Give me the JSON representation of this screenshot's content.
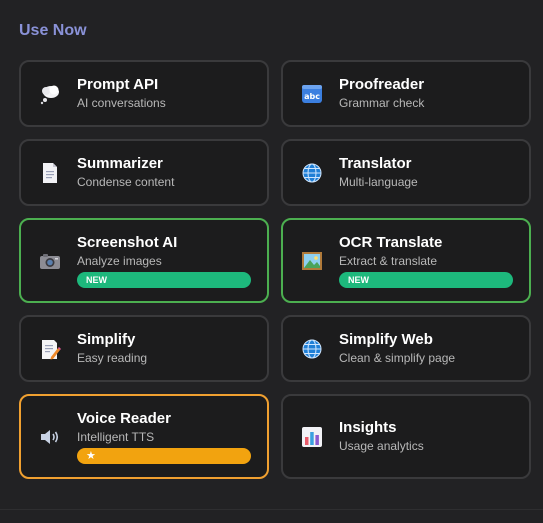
{
  "section": {
    "title": "Use Now"
  },
  "colors": {
    "background": "#222224",
    "section_title": "#8a92d8",
    "card_border": "#3a3a3c",
    "new_border": "#4caf50",
    "featured_border": "#f0a030",
    "new_badge": "#1db87c",
    "star_badge": "#f2a30f"
  },
  "cards": [
    {
      "name": "Prompt API",
      "desc": "AI conversations",
      "icon": "thought-bubble-icon"
    },
    {
      "name": "Proofreader",
      "desc": "Grammar check",
      "icon": "abc-icon"
    },
    {
      "name": "Summarizer",
      "desc": "Condense content",
      "icon": "document-icon"
    },
    {
      "name": "Translator",
      "desc": "Multi-language",
      "icon": "globe-icon"
    },
    {
      "name": "Screenshot AI",
      "desc": "Analyze images",
      "icon": "camera-icon",
      "badge": "NEW"
    },
    {
      "name": "OCR Translate",
      "desc": "Extract & translate",
      "icon": "framed-picture-icon",
      "badge": "NEW"
    },
    {
      "name": "Simplify",
      "desc": "Easy reading",
      "icon": "memo-icon"
    },
    {
      "name": "Simplify Web",
      "desc": "Clean & simplify page",
      "icon": "globe-icon"
    },
    {
      "name": "Voice Reader",
      "desc": "Intelligent TTS",
      "icon": "speaker-icon",
      "badge": "★"
    },
    {
      "name": "Insights",
      "desc": "Usage analytics",
      "icon": "bar-chart-icon"
    }
  ]
}
